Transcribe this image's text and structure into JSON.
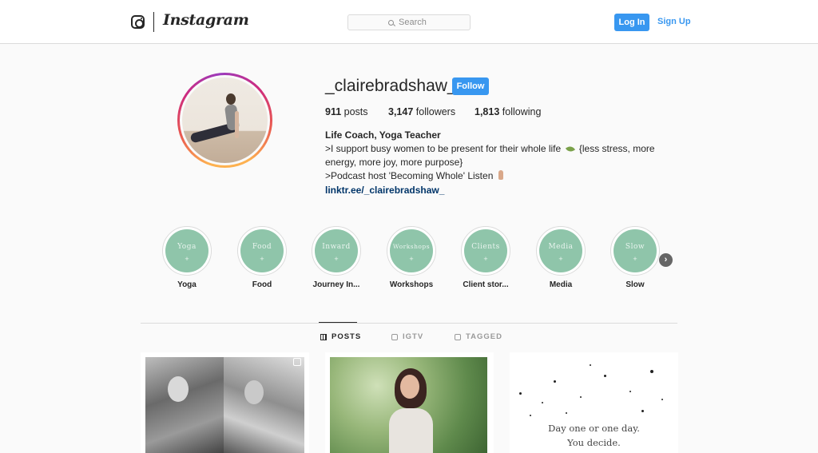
{
  "header": {
    "logo_text": "Instagram",
    "search_placeholder": "Search",
    "login_label": "Log In",
    "signup_label": "Sign Up",
    "accent_color": "#3897f0"
  },
  "profile": {
    "username": "_clairebradshaw_",
    "follow_label": "Follow",
    "posts_count": "911",
    "posts_label": "posts",
    "followers_count": "3,147",
    "followers_label": "followers",
    "following_count": "1,813",
    "following_label": "following",
    "bio_name": "Life Coach, Yoga Teacher",
    "bio_line1_a": ">I support busy women to be present for their whole life",
    "bio_line1_b": "{less stress, more",
    "bio_line2": "energy, more joy, more purpose}",
    "bio_line3": ">Podcast host 'Becoming Whole' Listen",
    "link": "linktr.ee/_clairebradshaw_"
  },
  "highlights": [
    {
      "cover": "Yoga",
      "label": "Yoga"
    },
    {
      "cover": "Food",
      "label": "Food"
    },
    {
      "cover": "Inward",
      "label": "Journey In..."
    },
    {
      "cover": "Workshops",
      "label": "Workshops"
    },
    {
      "cover": "Clients",
      "label": "Client stor..."
    },
    {
      "cover": "Media",
      "label": "Media"
    },
    {
      "cover": "Slow",
      "label": "Slow"
    }
  ],
  "tabs": {
    "posts": "POSTS",
    "igtv": "IGTV",
    "tagged": "TAGGED"
  },
  "posts": {
    "quote_line1": "Day one or one day.",
    "quote_line2": "You decide."
  }
}
